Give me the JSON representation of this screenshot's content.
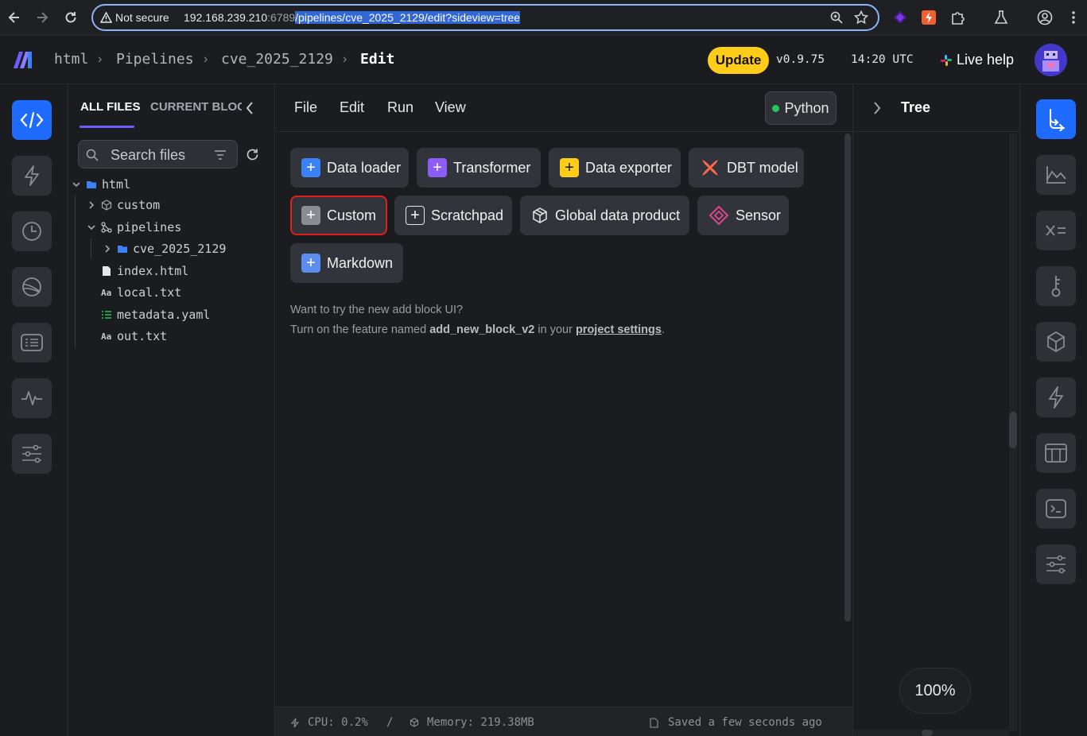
{
  "browser": {
    "security_label": "Not secure",
    "url_host": "192.168.239.210",
    "url_port": ":6789",
    "url_path": "/pipelines/cve_2025_2129/edit?sideview=tree"
  },
  "header": {
    "breadcrumbs": [
      "html",
      "Pipelines",
      "cve_2025_2129",
      "Edit"
    ],
    "update_label": "Update",
    "version": "v0.9.75",
    "time": "14:20 UTC",
    "live_help": "Live help"
  },
  "file_panel": {
    "tab_all": "ALL FILES",
    "tab_current": "CURRENT BLOCK",
    "search_placeholder": "Search files",
    "tree": [
      {
        "label": "html",
        "icon": "folder-icon"
      },
      {
        "label": "custom",
        "icon": "cube-icon"
      },
      {
        "label": "pipelines",
        "icon": "pipeline-icon"
      },
      {
        "label": "cve_2025_2129",
        "icon": "folder-icon"
      },
      {
        "label": "index.html",
        "icon": "file-icon"
      },
      {
        "label": "local.txt",
        "icon": "text-file-icon"
      },
      {
        "label": "metadata.yaml",
        "icon": "list-file-icon"
      },
      {
        "label": "out.txt",
        "icon": "text-file-icon"
      }
    ]
  },
  "editor": {
    "menus": [
      "File",
      "Edit",
      "Run",
      "View"
    ],
    "kernel_label": "Python",
    "blocks": [
      {
        "label": "Data loader",
        "color": "#3b82f6"
      },
      {
        "label": "Transformer",
        "color": "#8b5cf6"
      },
      {
        "label": "Data exporter",
        "color": "#ffcc19"
      },
      {
        "label": "DBT model",
        "color": "#ff6b4a"
      },
      {
        "label": "Custom",
        "color": "#8a8c93"
      },
      {
        "label": "Scratchpad",
        "color": "#e6e6e6"
      },
      {
        "label": "Global data product",
        "color": "#e6e6e6"
      },
      {
        "label": "Sensor",
        "color": "#ec4899"
      },
      {
        "label": "Markdown",
        "color": "#5b8def"
      }
    ],
    "hint_line1": "Want to try the new add block UI?",
    "hint_prefix": "Turn on the feature named ",
    "hint_feature": "add_new_block_v2",
    "hint_middle": " in your ",
    "hint_link": "project settings",
    "hint_suffix": ".",
    "status": {
      "cpu": "CPU: 0.2%",
      "separator": "/",
      "memory": "Memory: 219.38MB",
      "saved": "Saved a few seconds ago"
    }
  },
  "tree_panel": {
    "title": "Tree",
    "zoom": "100%"
  }
}
